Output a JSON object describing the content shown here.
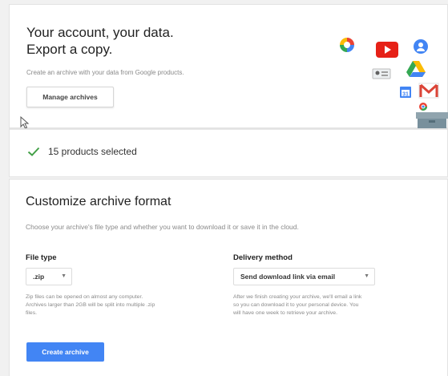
{
  "header": {
    "title_line1": "Your account, your data.",
    "title_line2": "Export a copy.",
    "subtitle": "Create an archive with your data from Google products.",
    "manage_button": "Manage archives"
  },
  "product_icons": [
    "photos-icon",
    "youtube-icon",
    "contacts-icon",
    "drive-icon",
    "gmail-icon",
    "calendar-icon",
    "voice-icon",
    "chrome-icon",
    "archive-box-icon"
  ],
  "selection": {
    "label": "15 products selected"
  },
  "format": {
    "title": "Customize archive format",
    "subtitle": "Choose your archive's file type and whether you want to download it or save it in the cloud.",
    "file_type": {
      "label": "File type",
      "value": ".zip",
      "help_line1": "Zip files can be opened on almost any computer.",
      "help_line2": "Archives larger than 2GB will be split into multiple .zip",
      "help_line3": "files."
    },
    "delivery": {
      "label": "Delivery method",
      "value": "Send download link via email",
      "help_line1": "After we finish creating your archive, we'll email a link",
      "help_line2": "so you can download it to your personal device. You",
      "help_line3": "will have one week to retrieve your archive."
    },
    "create_button": "Create archive"
  },
  "colors": {
    "accent": "#4285f4",
    "check": "#43a047"
  }
}
